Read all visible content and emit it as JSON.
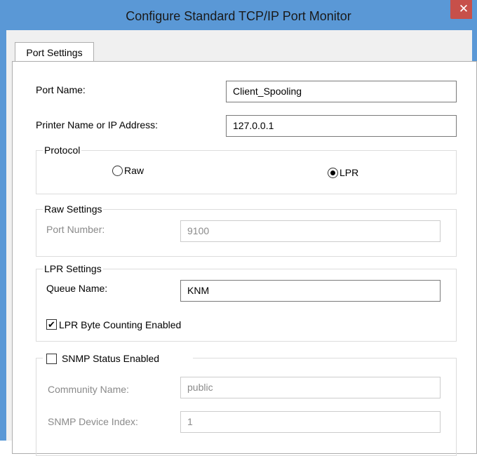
{
  "window": {
    "title": "Configure Standard TCP/IP Port Monitor",
    "close_glyph": "✕"
  },
  "tabs": [
    {
      "label": "Port Settings"
    }
  ],
  "port": {
    "name_label": "Port Name:",
    "name_value": "Client_Spooling",
    "address_label": "Printer Name or IP Address:",
    "address_value": "127.0.0.1"
  },
  "protocol": {
    "legend": "Protocol",
    "raw_label": "Raw",
    "lpr_label": "LPR",
    "selected": "LPR"
  },
  "raw_settings": {
    "legend": "Raw Settings",
    "port_number_label": "Port Number:",
    "port_number_value": "9100"
  },
  "lpr_settings": {
    "legend": "LPR Settings",
    "queue_name_label": "Queue Name:",
    "queue_name_value": "KNM",
    "byte_counting_label": "LPR Byte Counting Enabled",
    "byte_counting_checked": true,
    "check_glyph": "✔"
  },
  "snmp": {
    "enabled_label": "SNMP Status Enabled",
    "enabled_checked": false,
    "community_label": "Community Name:",
    "community_value": "public",
    "device_index_label": "SNMP Device Index:",
    "device_index_value": "1"
  },
  "colors": {
    "title_bar": "#5a98d6",
    "close_button": "#c7504a",
    "dialog_background": "#f0f0f0"
  }
}
